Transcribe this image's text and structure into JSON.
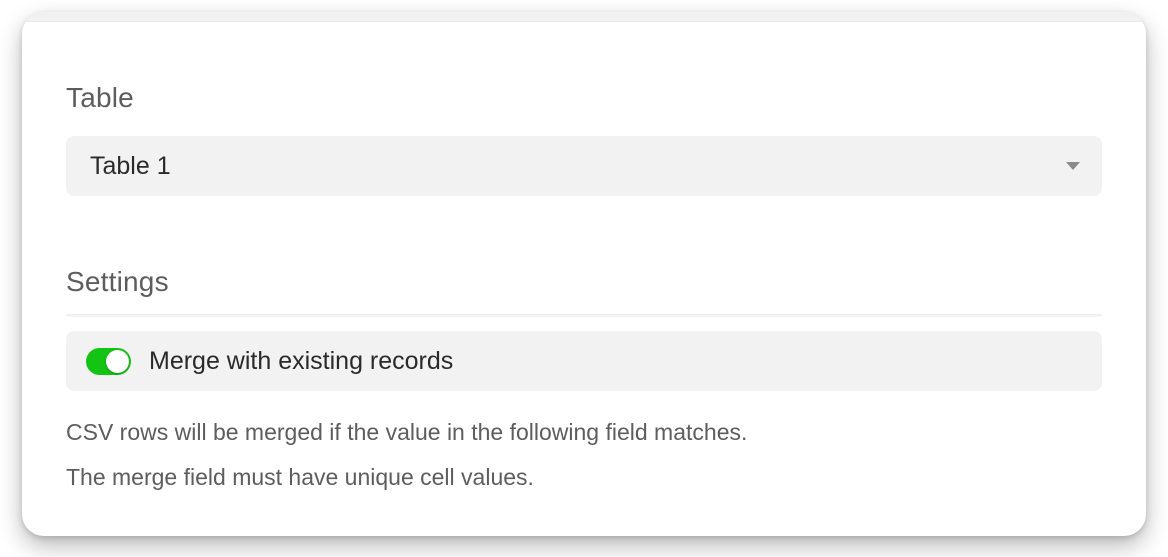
{
  "table": {
    "label": "Table",
    "selected": "Table 1"
  },
  "settings": {
    "label": "Settings",
    "merge_toggle": {
      "label": "Merge with existing records",
      "on": true
    },
    "help_line_1": "CSV rows will be merged if the value in the following field matches.",
    "help_line_2": "The merge field must have unique cell values."
  }
}
